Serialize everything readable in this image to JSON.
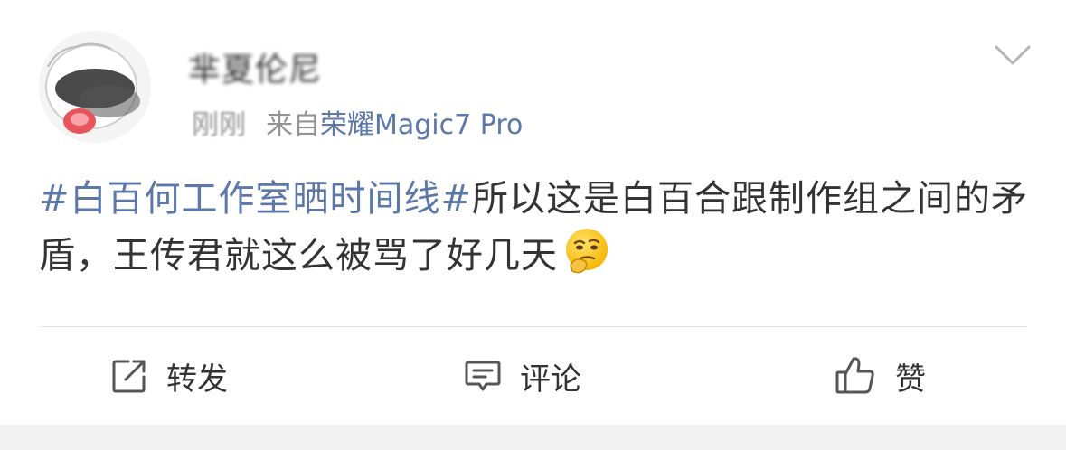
{
  "post": {
    "username": "芈夏伦尼",
    "time": "刚刚",
    "source_prefix": "来自",
    "source_device": "荣耀Magic7 Pro",
    "topic": "#白百何工作室晒时间线#",
    "body": "所以这是白百合跟制作组之间的矛盾，王传君就这么被骂了好几天",
    "emoji": "thinking-face-emoji"
  },
  "actions": {
    "repost_label": "转发",
    "comment_label": "评论",
    "like_label": "赞"
  },
  "colors": {
    "link": "#5b78a8",
    "text": "#333333",
    "meta": "#939393",
    "divider": "#e6e6e6",
    "footer_bg": "#f2f2f2"
  }
}
